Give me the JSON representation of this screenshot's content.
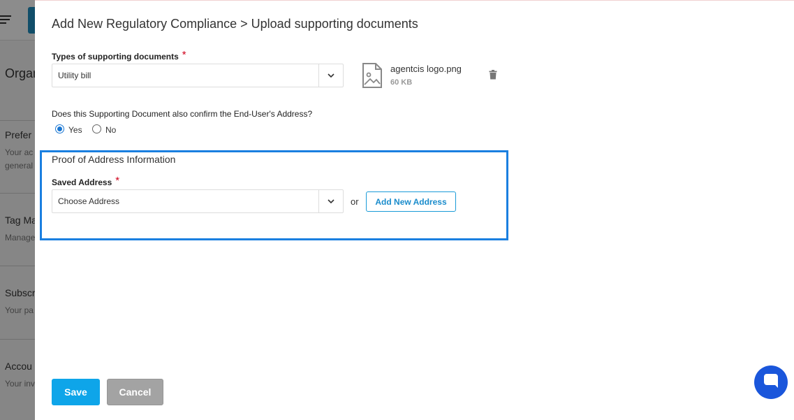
{
  "background": {
    "heading": "Organ",
    "sections": [
      {
        "title": "Prefer",
        "subtitle": "Your ac",
        "subtitle2": "general"
      },
      {
        "title": "Tag Ma",
        "subtitle": "Manage"
      },
      {
        "title": "Subscr",
        "subtitle": "Your pa"
      },
      {
        "title": "Accou",
        "subtitle": "Your inv"
      }
    ]
  },
  "drawer": {
    "title": "Add New Regulatory Compliance > Upload supporting documents",
    "doc_type": {
      "label": "Types of supporting documents",
      "required_mark": "*",
      "value": "Utility bill"
    },
    "file": {
      "name": "agentcis logo.png",
      "size": "60 KB"
    },
    "address_question": {
      "text": "Does this Supporting Document also confirm the End-User's Address?",
      "options": [
        {
          "label": "Yes",
          "selected": true
        },
        {
          "label": "No",
          "selected": false
        }
      ]
    },
    "proof_of_address": {
      "title": "Proof of Address Information",
      "saved_address_label": "Saved Address",
      "required_mark": "*",
      "saved_address_value": "Choose Address",
      "or_text": "or",
      "add_new_label": "Add New Address"
    },
    "actions": {
      "save_label": "Save",
      "cancel_label": "Cancel"
    }
  },
  "colors": {
    "primary": "#0ea5e9",
    "highlight_border": "#1a7fe0",
    "chat": "#1a56db",
    "required": "#d0021b"
  }
}
